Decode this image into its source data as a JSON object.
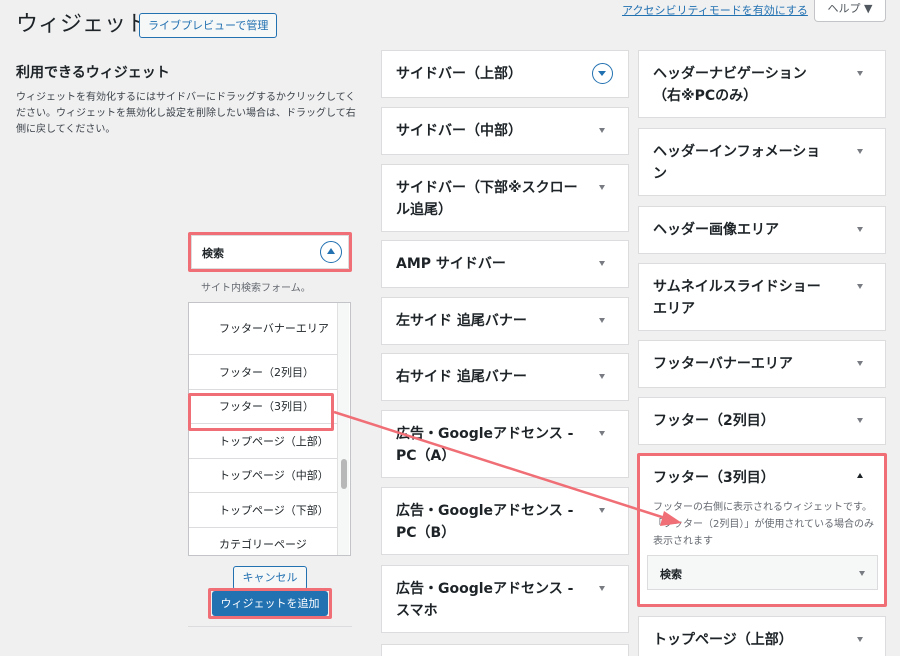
{
  "header": {
    "title": "ウィジェット",
    "preview_button": "ライブプレビューで管理",
    "accessibility_link": "アクセシビリティモードを有効にする",
    "help_button": "ヘルプ ▼"
  },
  "available": {
    "title": "利用できるウィジェット",
    "description": "ウィジェットを有効化するにはサイドバーにドラッグするかクリックしてください。ウィジェットを無効化し設定を削除したい場合は、ドラッグして右側に戻してください。",
    "search_widget": {
      "label": "検索",
      "description": "サイト内検索フォーム。"
    },
    "chooser": {
      "items": [
        "フッターバナーエリア",
        "フッター（2列目）",
        "フッター（3列目）",
        "トップページ（上部）",
        "トップページ（中部）",
        "トップページ（下部）",
        "カテゴリーページ"
      ]
    },
    "cancel_button": "キャンセル",
    "add_button": "ウィジェットを追加"
  },
  "sidebars_mid": [
    "サイドバー（上部）",
    "サイドバー（中部）",
    "サイドバー（下部※スクロール追尾）",
    "AMP サイドバー",
    "左サイド 追尾バナー",
    "右サイド 追尾バナー",
    "広告・Googleアドセンス - PC（A）",
    "広告・Googleアドセンス - PC（B）",
    "広告・Googleアドセンス - スマホ"
  ],
  "sidebars_right": [
    "ヘッダーナビゲーション（右※PCのみ）",
    "ヘッダーインフォメーション",
    "ヘッダー画像エリア",
    "サムネイルスライドショーエリア",
    "フッターバナーエリア",
    "フッター（2列目）"
  ],
  "footer3": {
    "title": "フッター（3列目）",
    "description": "フッターの右側に表示されるウィジェットです。「フッター（2列目）」が使用されている場合のみ表示されます",
    "widget": "検索"
  },
  "top_page_upper": "トップページ（上部）",
  "colors": {
    "accent": "#2271b1",
    "highlight": "#f06e75"
  }
}
